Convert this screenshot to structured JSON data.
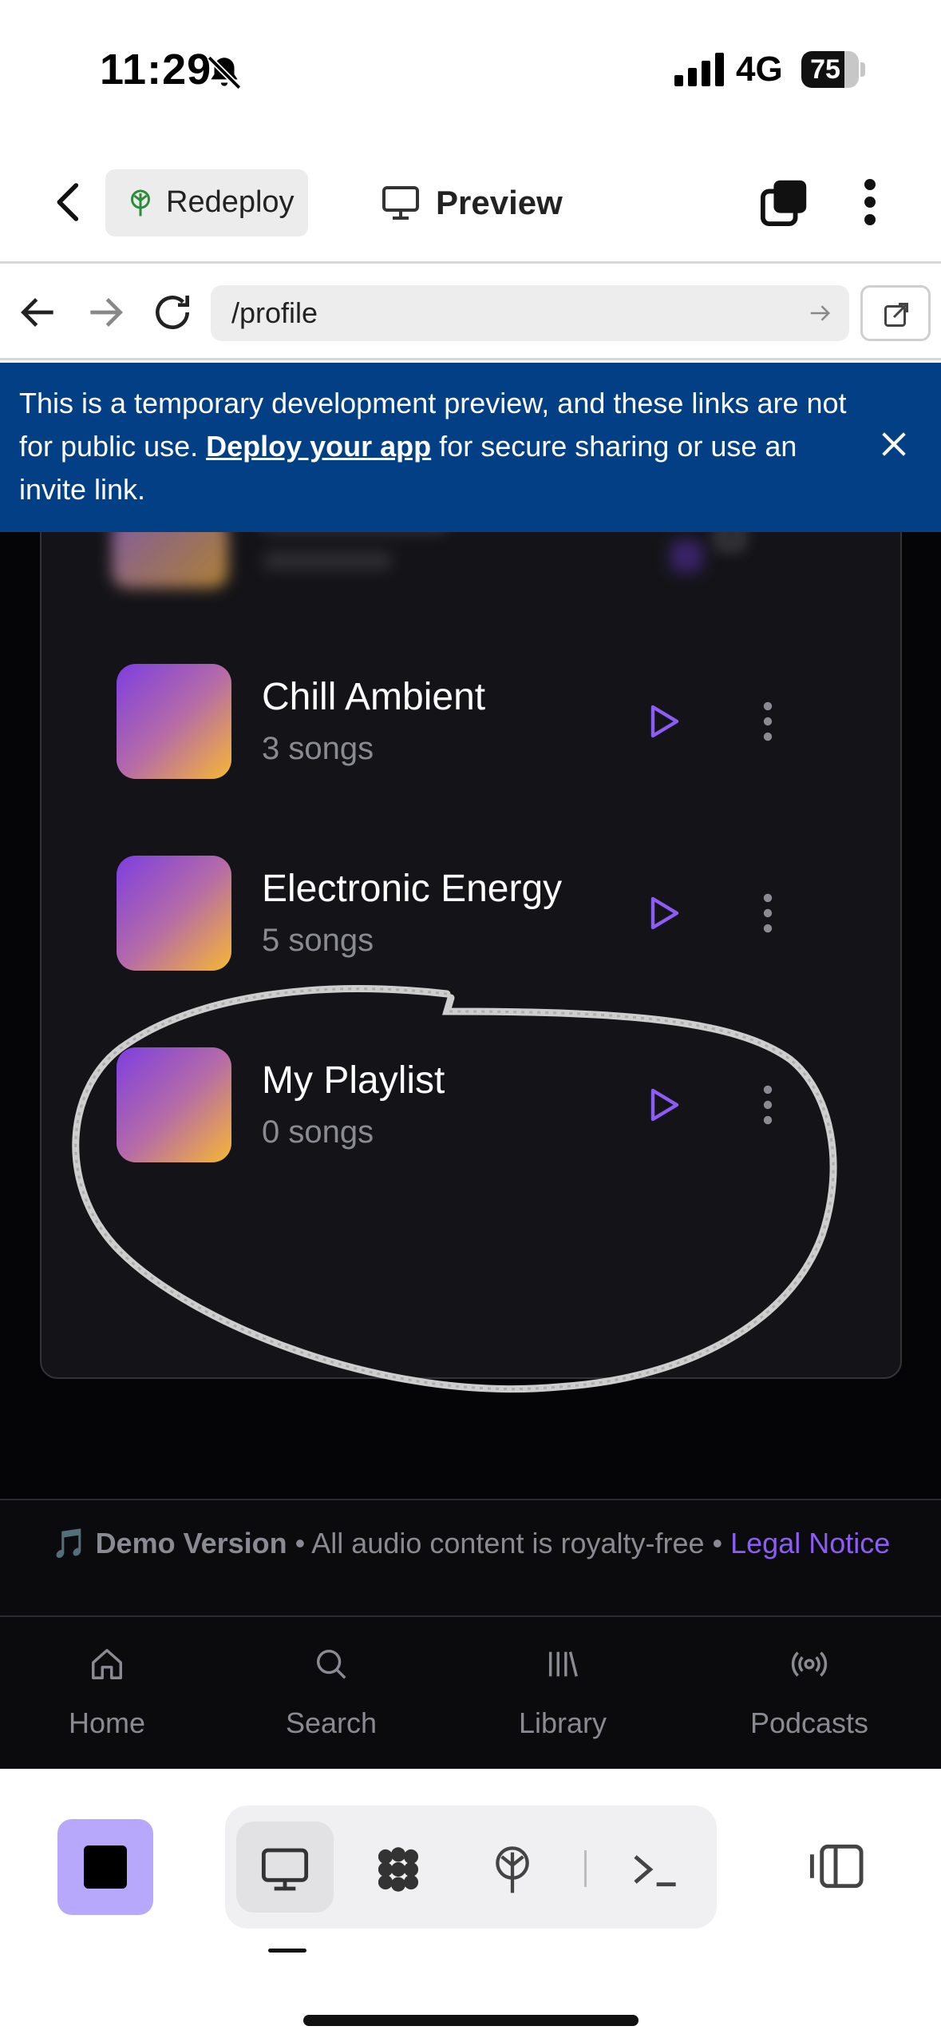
{
  "status": {
    "time": "11:29",
    "network": "4G",
    "battery": "75",
    "battery_level": 0.75
  },
  "header": {
    "redeploy_label": "Redeploy",
    "preview_label": "Preview"
  },
  "urlbar": {
    "url": "/profile"
  },
  "banner": {
    "text_before": "This is a temporary development preview, and these links are not for public use. ",
    "link_text": "Deploy your app",
    "text_after": " for secure sharing or use an invite link."
  },
  "playlists": [
    {
      "name": "Chill Ambient",
      "count": "3 songs"
    },
    {
      "name": "Electronic Energy",
      "count": "5 songs"
    },
    {
      "name": "My Playlist",
      "count": "0 songs"
    }
  ],
  "footer": {
    "icon": "🎵",
    "demo": "Demo Version",
    "sep1": " • ",
    "notice": "All audio content is royalty-free",
    "sep2": " • ",
    "legal_link": "Legal Notice"
  },
  "tabs": [
    {
      "label": "Home",
      "icon": "home-icon"
    },
    {
      "label": "Search",
      "icon": "search-icon"
    },
    {
      "label": "Library",
      "icon": "library-icon"
    },
    {
      "label": "Podcasts",
      "icon": "podcasts-icon"
    }
  ],
  "colors": {
    "accent": "#8b5cf6",
    "banner": "#023f84",
    "background": "#050508",
    "stop_button": "#b8a8fb"
  }
}
